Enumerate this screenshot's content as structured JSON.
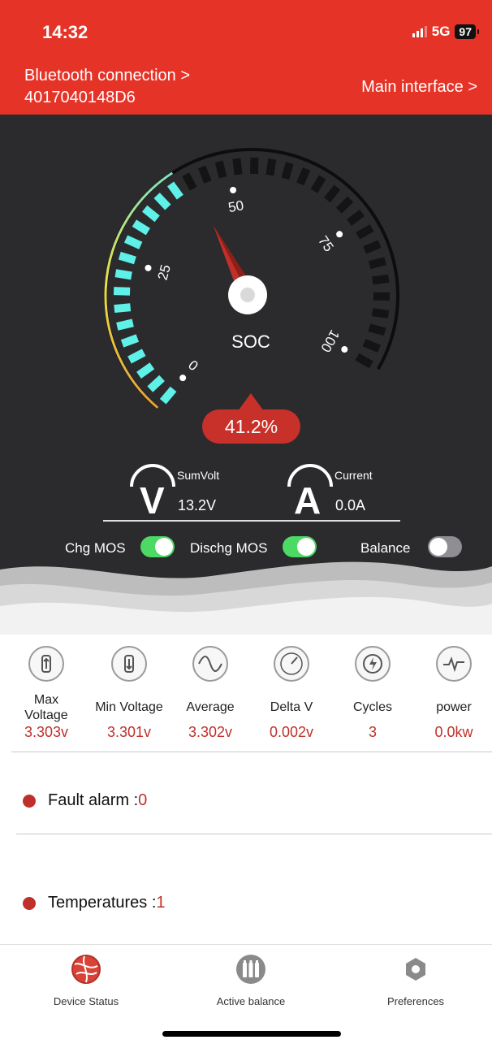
{
  "status": {
    "time": "14:32",
    "network": "5G",
    "battery": "97"
  },
  "header": {
    "bluetooth_label": "Bluetooth connection >",
    "device_id": "4017040148D6",
    "main_interface_link": "Main interface >"
  },
  "gauge": {
    "title": "SOC",
    "value_text": "41.2%",
    "soc_percent": 41.2,
    "ticks": [
      "0",
      "25",
      "50",
      "75",
      "100"
    ]
  },
  "metrics": {
    "sum_volt_label": "SumVolt",
    "sum_volt_value": "13.2V",
    "sum_volt_glyph": "V",
    "current_label": "Current",
    "current_value": "0.0A",
    "current_glyph": "A"
  },
  "switches": {
    "chg_mos_label": "Chg MOS",
    "chg_mos_on": true,
    "dischg_mos_label": "Dischg MOS",
    "dischg_mos_on": true,
    "balance_label": "Balance",
    "balance_on": false
  },
  "stats": [
    {
      "icon": "max-voltage-icon",
      "label": "Max\nVoltage",
      "value": "3.303v"
    },
    {
      "icon": "min-voltage-icon",
      "label": "Min Voltage",
      "value": "3.301v"
    },
    {
      "icon": "average-icon",
      "label": "Average",
      "value": "3.302v"
    },
    {
      "icon": "delta-v-icon",
      "label": "Delta V",
      "value": "0.002v"
    },
    {
      "icon": "cycles-icon",
      "label": "Cycles",
      "value": "3"
    },
    {
      "icon": "power-icon",
      "label": "power",
      "value": "0.0kw"
    }
  ],
  "alarms": {
    "fault_label": "Fault alarm :",
    "fault_count": "0",
    "temp_label": "Temperatures :",
    "temp_count": "1"
  },
  "tabs": [
    {
      "label": "Device Status",
      "icon": "device-status-icon",
      "active": true
    },
    {
      "label": "Active balance",
      "icon": "active-balance-icon",
      "active": false
    },
    {
      "label": "Preferences",
      "icon": "preferences-icon",
      "active": false
    }
  ],
  "colors": {
    "brand_red": "#e63327",
    "gauge_fill": "#5ff0e8",
    "toggle_on": "#4cd964",
    "value_red": "#c0302a"
  }
}
